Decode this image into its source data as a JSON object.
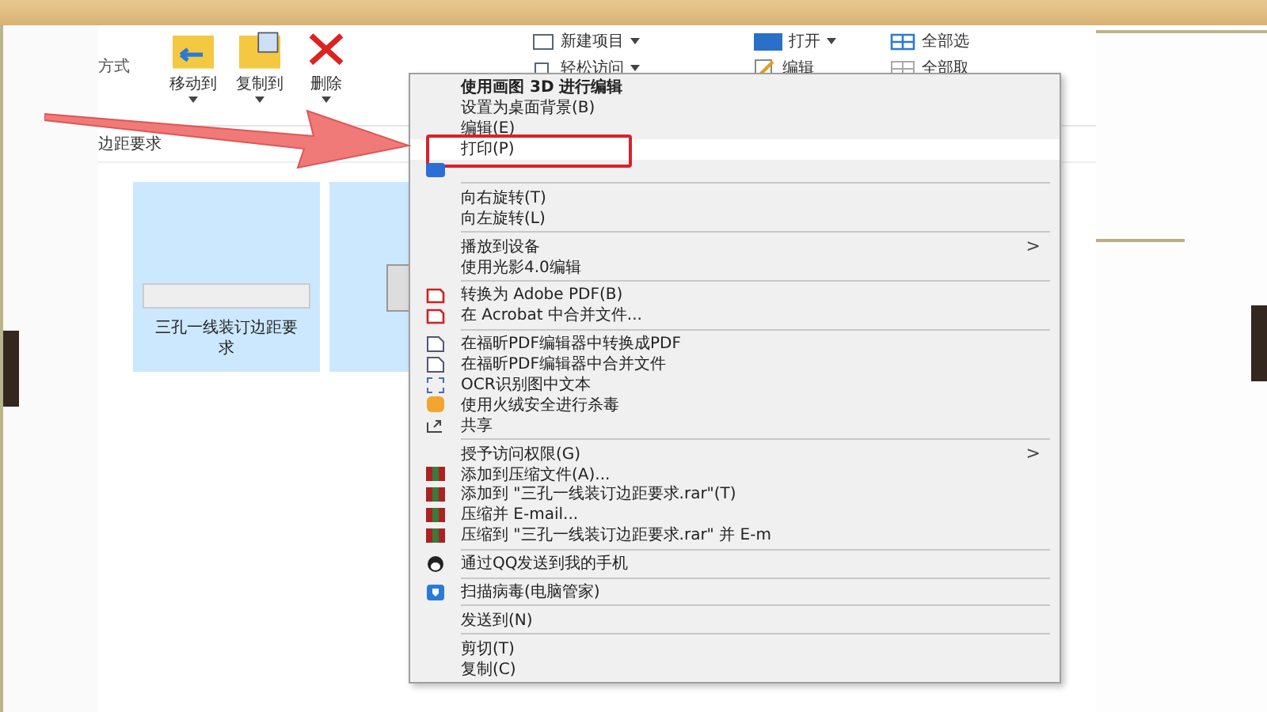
{
  "ribbon": {
    "left_label": "方式",
    "buttons": [
      {
        "label": "移动到",
        "dropdown": true
      },
      {
        "label": "复制到",
        "dropdown": true
      },
      {
        "label": "删除",
        "dropdown": true
      }
    ],
    "small_buttons": [
      {
        "label": "新建项目",
        "dropdown": true
      },
      {
        "label": "轻松访问",
        "dropdown": true
      },
      {
        "label": "打开",
        "dropdown": true
      },
      {
        "label": "编辑",
        "dropdown": false
      },
      {
        "label": "全部选",
        "dropdown": false
      },
      {
        "label": "全部取",
        "dropdown": false
      }
    ]
  },
  "address": "边距要求",
  "files": [
    {
      "name": "三孔一线装订边距要求",
      "selected": true
    }
  ],
  "menu": [
    {
      "kind": "item",
      "label": "使用画图 3D 进行编辑",
      "bold": true,
      "selected": false,
      "boxed": false
    },
    {
      "kind": "item",
      "label": "设置为桌面背景(B)",
      "bold": false,
      "selected": false,
      "boxed": false
    },
    {
      "kind": "item",
      "label": "编辑(E)",
      "bold": false,
      "selected": false,
      "boxed": false
    },
    {
      "kind": "item",
      "label": "打印(P)",
      "bold": false,
      "selected": true,
      "boxed": true
    },
    {
      "kind": "item",
      "selected": false,
      "boxed": false
    },
    {
      "kind": "separator"
    },
    {
      "kind": "item",
      "label": "向右旋转(T)",
      "bold": false,
      "selected": false,
      "boxed": false
    },
    {
      "kind": "item",
      "label": "向左旋转(L)",
      "bold": false,
      "selected": false,
      "boxed": false
    },
    {
      "kind": "separator"
    },
    {
      "kind": "item",
      "label": "播放到设备",
      "bold": false,
      "selected": false,
      "boxed": false,
      "arrow": ">"
    },
    {
      "kind": "item",
      "label": "使用光影4.0编辑",
      "bold": false,
      "selected": false,
      "boxed": false
    },
    {
      "kind": "separator"
    },
    {
      "kind": "item",
      "label": "转换为 Adobe PDF(B)",
      "bold": false,
      "selected": false,
      "boxed": false
    },
    {
      "kind": "item",
      "label": "在 Acrobat 中合并文件...",
      "bold": false,
      "selected": false,
      "boxed": false
    },
    {
      "kind": "separator"
    },
    {
      "kind": "item",
      "label": "在福昕PDF编辑器中转换成PDF",
      "bold": false,
      "selected": false,
      "boxed": false
    },
    {
      "kind": "item",
      "label": "在福昕PDF编辑器中合并文件",
      "bold": false,
      "selected": false,
      "boxed": false
    },
    {
      "kind": "item",
      "label": "OCR识别图中文本",
      "bold": false,
      "selected": false,
      "boxed": false
    },
    {
      "kind": "item",
      "label": "使用火绒安全进行杀毒",
      "bold": false,
      "selected": false,
      "boxed": false
    },
    {
      "kind": "item",
      "label": "共享",
      "bold": false,
      "selected": false,
      "boxed": false
    },
    {
      "kind": "separator"
    },
    {
      "kind": "item",
      "label": "授予访问权限(G)",
      "bold": false,
      "selected": false,
      "boxed": false,
      "arrow": ">"
    },
    {
      "kind": "item",
      "label": "添加到压缩文件(A)...",
      "bold": false,
      "selected": false,
      "boxed": false
    },
    {
      "kind": "item",
      "label": "添加到 \"三孔一线装订边距要求.rar\"(T)",
      "bold": false,
      "selected": false,
      "boxed": false
    },
    {
      "kind": "item",
      "label": "压缩并 E-mail...",
      "bold": false,
      "selected": false,
      "boxed": false
    },
    {
      "kind": "item",
      "label": "压缩到 \"三孔一线装订边距要求.rar\" 并 E-m",
      "bold": false,
      "selected": false,
      "boxed": false
    },
    {
      "kind": "separator"
    },
    {
      "kind": "item",
      "label": "通过QQ发送到我的手机",
      "bold": false,
      "selected": false,
      "boxed": false
    },
    {
      "kind": "separator"
    },
    {
      "kind": "item",
      "label": "扫描病毒(电脑管家)",
      "bold": false,
      "selected": false,
      "boxed": false
    },
    {
      "kind": "separator"
    },
    {
      "kind": "item",
      "label": "发送到(N)",
      "bold": false,
      "selected": false,
      "boxed": false
    },
    {
      "kind": "separator"
    },
    {
      "kind": "item",
      "label": "剪切(T)",
      "bold": false,
      "selected": false,
      "boxed": false
    },
    {
      "kind": "item",
      "label": "复制(C)",
      "bold": false,
      "selected": false,
      "boxed": false
    }
  ]
}
